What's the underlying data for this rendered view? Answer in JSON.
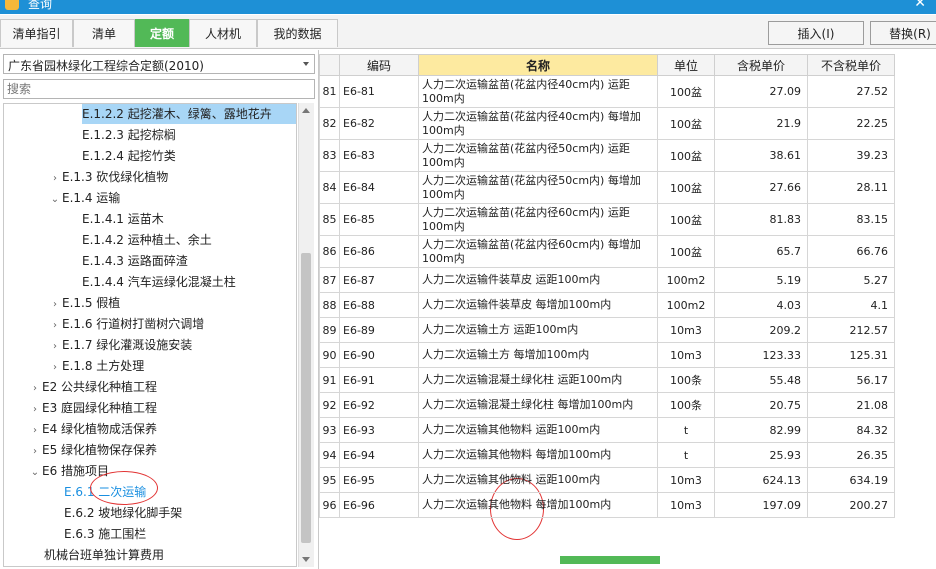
{
  "window": {
    "title": "查询"
  },
  "tabs": [
    {
      "label": "清单指引",
      "active": false
    },
    {
      "label": "清单",
      "active": false
    },
    {
      "label": "定额",
      "active": true
    },
    {
      "label": "人材机",
      "active": false
    },
    {
      "label": "我的数据",
      "active": false
    }
  ],
  "toolbar": {
    "insert_label": "插入(I)",
    "replace_label": "替换(R)"
  },
  "left": {
    "library_select": "广东省园林绿化工程综合定额(2010)",
    "search_placeholder": "搜索"
  },
  "tree": [
    {
      "label": "E.1.2.2 起挖灌木、绿篱、露地花卉",
      "caret": "",
      "selected": true
    },
    {
      "label": "E.1.2.3 起挖棕榈",
      "caret": ""
    },
    {
      "label": "E.1.2.4 起挖竹类",
      "caret": ""
    },
    {
      "label": "E.1.3 砍伐绿化植物",
      "caret": "›"
    },
    {
      "label": "E.1.4 运输",
      "caret": "⌄"
    },
    {
      "label": "E.1.4.1 运苗木",
      "caret": ""
    },
    {
      "label": "E.1.4.2 运种植土、余土",
      "caret": ""
    },
    {
      "label": "E.1.4.3 运路面碎渣",
      "caret": ""
    },
    {
      "label": "E.1.4.4 汽车运绿化混凝土柱",
      "caret": ""
    },
    {
      "label": "E.1.5 假植",
      "caret": "›"
    },
    {
      "label": "E.1.6 行道树打凿树穴调增",
      "caret": "›"
    },
    {
      "label": "E.1.7 绿化灌溉设施安装",
      "caret": "›"
    },
    {
      "label": "E.1.8 土方处理",
      "caret": "›"
    },
    {
      "label": "E2 公共绿化种植工程",
      "caret": "›"
    },
    {
      "label": "E3 庭园绿化种植工程",
      "caret": "›"
    },
    {
      "label": "E4 绿化植物成活保养",
      "caret": "›"
    },
    {
      "label": "E5 绿化植物保存保养",
      "caret": "›"
    },
    {
      "label": "E6 措施项目",
      "caret": "⌄"
    },
    {
      "label": "E.6.1 二次运输",
      "caret": "",
      "current": true
    },
    {
      "label": "E.6.2 坡地绿化脚手架",
      "caret": ""
    },
    {
      "label": "E.6.3 施工围栏",
      "caret": ""
    },
    {
      "label": "机械台班单独计算费用",
      "caret": ""
    }
  ],
  "table": {
    "headers": [
      "",
      "编码",
      "名称",
      "单位",
      "含税单价",
      "不含税单价"
    ],
    "rows": [
      {
        "no": "81",
        "code": "E6-81",
        "name": "人力二次运输盆苗(花盆内径40cm内) 运距100m内",
        "unit": "100盆",
        "tax_price": "27.09",
        "notax_price": "27.52"
      },
      {
        "no": "82",
        "code": "E6-82",
        "name": "人力二次运输盆苗(花盆内径40cm内) 每增加100m内",
        "unit": "100盆",
        "tax_price": "21.9",
        "notax_price": "22.25"
      },
      {
        "no": "83",
        "code": "E6-83",
        "name": "人力二次运输盆苗(花盆内径50cm内) 运距100m内",
        "unit": "100盆",
        "tax_price": "38.61",
        "notax_price": "39.23"
      },
      {
        "no": "84",
        "code": "E6-84",
        "name": "人力二次运输盆苗(花盆内径50cm内) 每增加100m内",
        "unit": "100盆",
        "tax_price": "27.66",
        "notax_price": "28.11"
      },
      {
        "no": "85",
        "code": "E6-85",
        "name": "人力二次运输盆苗(花盆内径60cm内) 运距100m内",
        "unit": "100盆",
        "tax_price": "81.83",
        "notax_price": "83.15"
      },
      {
        "no": "86",
        "code": "E6-86",
        "name": "人力二次运输盆苗(花盆内径60cm内) 每增加100m内",
        "unit": "100盆",
        "tax_price": "65.7",
        "notax_price": "66.76"
      },
      {
        "no": "87",
        "code": "E6-87",
        "name": "人力二次运输件装草皮 运距100m内",
        "unit": "100m2",
        "tax_price": "5.19",
        "notax_price": "5.27"
      },
      {
        "no": "88",
        "code": "E6-88",
        "name": "人力二次运输件装草皮 每增加100m内",
        "unit": "100m2",
        "tax_price": "4.03",
        "notax_price": "4.1"
      },
      {
        "no": "89",
        "code": "E6-89",
        "name": "人力二次运输土方 运距100m内",
        "unit": "10m3",
        "tax_price": "209.2",
        "notax_price": "212.57"
      },
      {
        "no": "90",
        "code": "E6-90",
        "name": "人力二次运输土方 每增加100m内",
        "unit": "10m3",
        "tax_price": "123.33",
        "notax_price": "125.31"
      },
      {
        "no": "91",
        "code": "E6-91",
        "name": "人力二次运输混凝土绿化柱 运距100m内",
        "unit": "100条",
        "tax_price": "55.48",
        "notax_price": "56.17"
      },
      {
        "no": "92",
        "code": "E6-92",
        "name": "人力二次运输混凝土绿化柱 每增加100m内",
        "unit": "100条",
        "tax_price": "20.75",
        "notax_price": "21.08"
      },
      {
        "no": "93",
        "code": "E6-93",
        "name": "人力二次运输其他物料 运距100m内",
        "unit": "t",
        "tax_price": "82.99",
        "notax_price": "84.32"
      },
      {
        "no": "94",
        "code": "E6-94",
        "name": "人力二次运输其他物料 每增加100m内",
        "unit": "t",
        "tax_price": "25.93",
        "notax_price": "26.35"
      },
      {
        "no": "95",
        "code": "E6-95",
        "name": "人力二次运输其他物料 运距100m内",
        "unit": "10m3",
        "tax_price": "624.13",
        "notax_price": "634.19"
      },
      {
        "no": "96",
        "code": "E6-96",
        "name": "人力二次运输其他物料 每增加100m内",
        "unit": "10m3",
        "tax_price": "197.09",
        "notax_price": "200.27"
      }
    ]
  },
  "colors": {
    "titlebar": "#1e90d6",
    "active_tab": "#52b957",
    "name_header": "#fdeaa0",
    "selection": "#a8d6f6",
    "annotation": "#e23434"
  }
}
